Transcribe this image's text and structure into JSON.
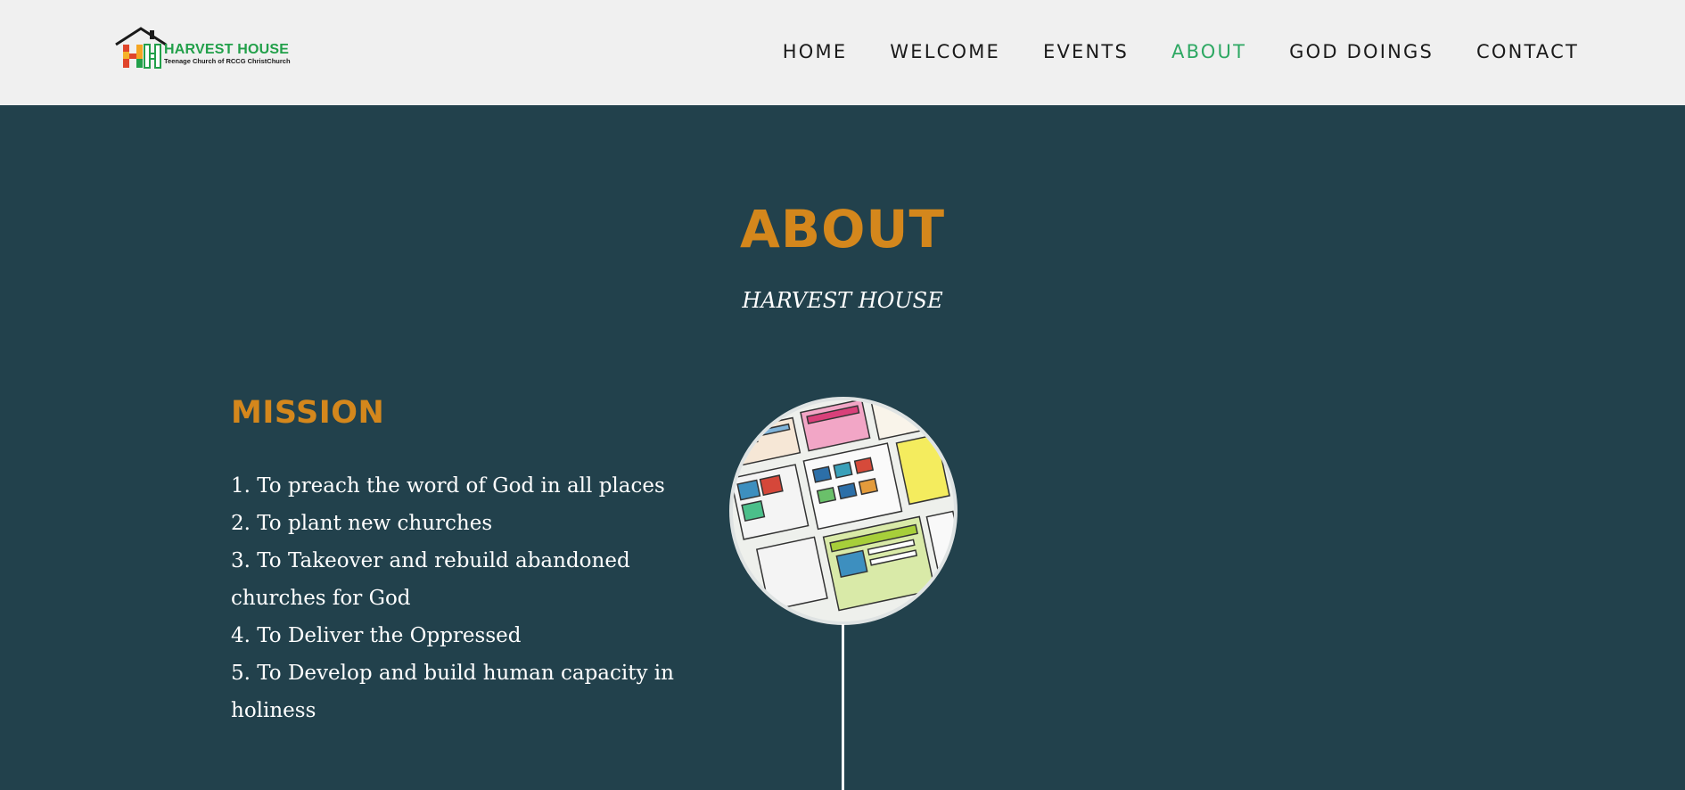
{
  "header": {
    "logo_name": "HARVEST HOUSE",
    "logo_tagline": "Teenage Church of RCCG ChristChurch"
  },
  "nav": {
    "items": [
      {
        "label": "HOME"
      },
      {
        "label": "WELCOME"
      },
      {
        "label": "EVENTS"
      },
      {
        "label": "ABOUT",
        "active": true
      },
      {
        "label": "GOD DOINGS"
      },
      {
        "label": "CONTACT"
      }
    ],
    "active_color": "#2ea863"
  },
  "hero": {
    "title": "ABOUT",
    "subtitle": "HARVEST HOUSE"
  },
  "mission": {
    "heading": "MISSION",
    "items": [
      "1. To preach the word of God in all places",
      "2. To plant new churches",
      "3. To Takeover and rebuild abandoned churches for God",
      "4. To Deliver the Oppressed",
      "5. To Develop and build human capacity in holiness"
    ]
  },
  "colors": {
    "background": "#22414c",
    "header_bg": "#f0f0f0",
    "accent_orange": "#d4871c",
    "logo_green": "#22a04a"
  }
}
